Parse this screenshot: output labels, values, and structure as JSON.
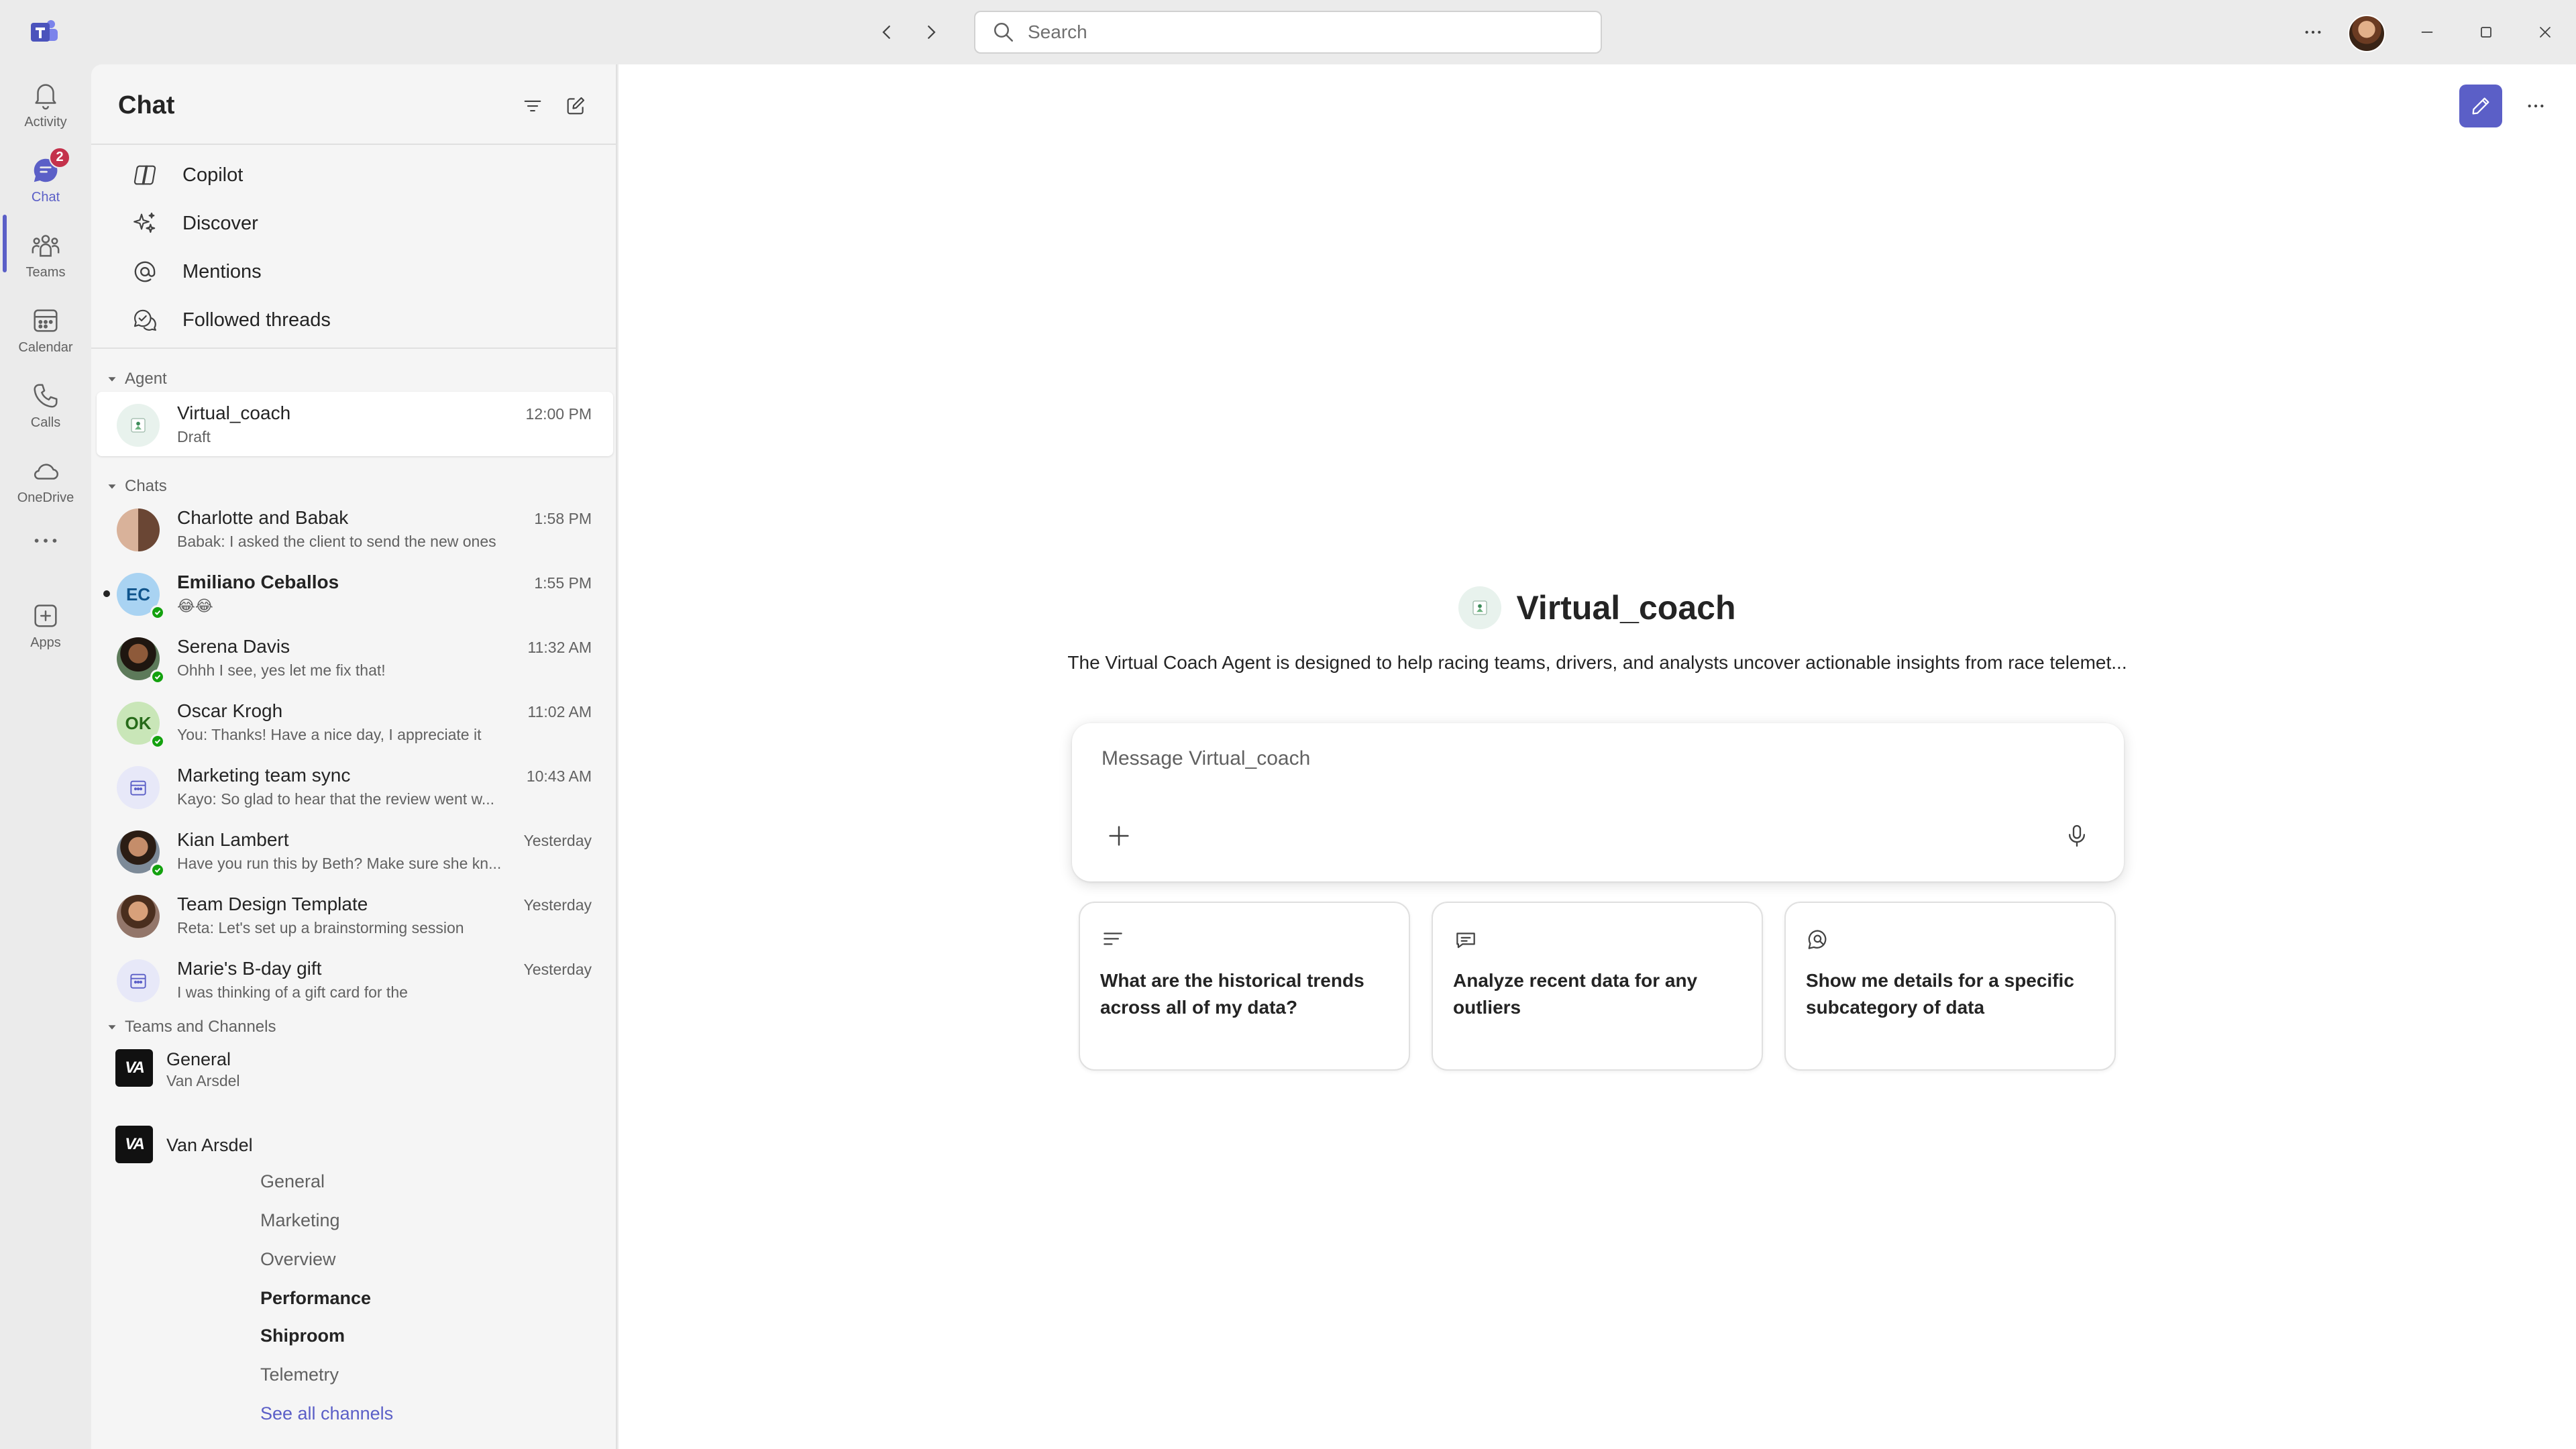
{
  "titlebar": {
    "search_placeholder": "Search"
  },
  "rail": {
    "items": [
      {
        "label": "Activity",
        "icon": "bell-icon"
      },
      {
        "label": "Chat",
        "icon": "chat-icon",
        "badge": "2",
        "active": true
      },
      {
        "label": "Teams",
        "icon": "teams-icon"
      },
      {
        "label": "Calendar",
        "icon": "calendar-icon"
      },
      {
        "label": "Calls",
        "icon": "phone-icon"
      },
      {
        "label": "OneDrive",
        "icon": "cloud-icon"
      },
      {
        "label": "",
        "icon": "more-icon"
      },
      {
        "label": "Apps",
        "icon": "add-app-icon"
      }
    ]
  },
  "chat_pane": {
    "title": "Chat",
    "nav": [
      {
        "label": "Copilot",
        "icon": "copilot-icon"
      },
      {
        "label": "Discover",
        "icon": "sparkle-icon"
      },
      {
        "label": "Mentions",
        "icon": "at-icon"
      },
      {
        "label": "Followed threads",
        "icon": "followed-threads-icon"
      }
    ],
    "agent_section": "Agent",
    "agent": {
      "name": "Virtual_coach",
      "preview": "Draft",
      "time": "12:00 PM"
    },
    "chats_section": "Chats",
    "chats": [
      {
        "name": "Charlotte and Babak",
        "preview": "Babak: I asked the client to send the new ones",
        "time": "1:58 PM"
      },
      {
        "name": "Emiliano Ceballos",
        "preview": "😂😂",
        "time": "1:55 PM",
        "initials": "EC"
      },
      {
        "name": "Serena Davis",
        "preview": "Ohhh I see, yes let me fix that!",
        "time": "11:32 AM"
      },
      {
        "name": "Oscar Krogh",
        "preview": "You: Thanks! Have a nice day, I appreciate it",
        "time": "11:02 AM",
        "initials": "OK"
      },
      {
        "name": "Marketing team sync",
        "preview": "Kayo: So glad to hear that the review went w...",
        "time": "10:43 AM"
      },
      {
        "name": "Kian Lambert",
        "preview": "Have you run this by Beth? Make sure she kn...",
        "time": "Yesterday"
      },
      {
        "name": "Team Design Template",
        "preview": "Reta: Let's set up a brainstorming session",
        "time": "Yesterday"
      },
      {
        "name": "Marie's B-day gift",
        "preview": "I was thinking of a gift card for the",
        "time": "Yesterday"
      }
    ],
    "teams_section": "Teams and Channels",
    "teams": [
      {
        "name": "General",
        "sub": "Van Arsdel",
        "logo": "VA"
      },
      {
        "name": "Van Arsdel",
        "sub": "",
        "logo": "VA"
      }
    ],
    "channels": [
      "General",
      "Marketing",
      "Overview",
      "Performance",
      "Shiproom",
      "Telemetry"
    ],
    "see_all": "See all channels"
  },
  "main": {
    "agent_name": "Virtual_coach",
    "description": "The Virtual Coach Agent is designed to help racing teams, drivers, and analysts uncover actionable insights from race telemet...",
    "message_placeholder": "Message Virtual_coach",
    "prompts": [
      {
        "text": "What are the historical trends across all of my data?",
        "icon": "text-lines-icon"
      },
      {
        "text": "Analyze recent data for any outliers",
        "icon": "analyze-icon"
      },
      {
        "text": "Show me details for a specific subcategory of data",
        "icon": "chat-search-icon"
      }
    ]
  }
}
